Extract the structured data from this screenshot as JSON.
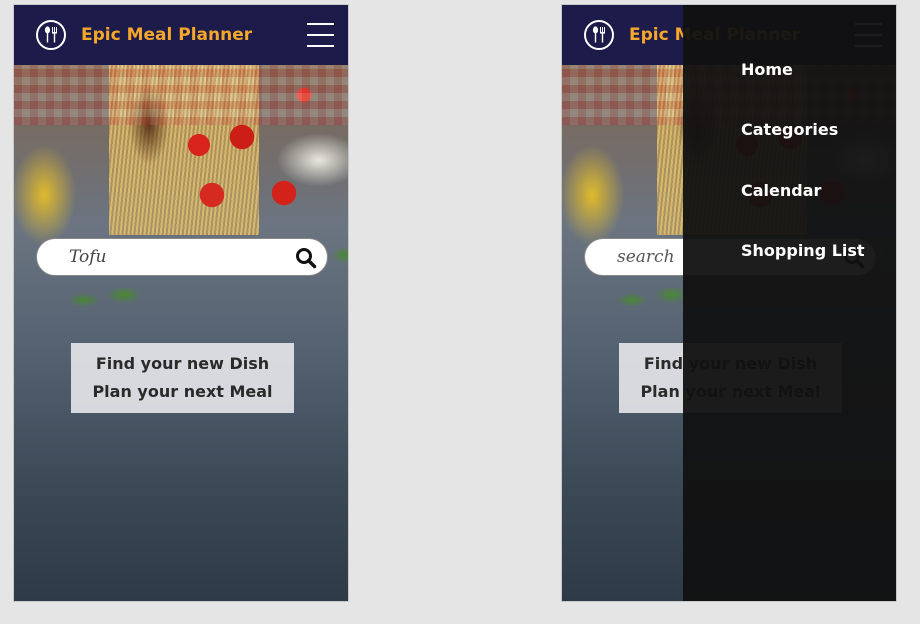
{
  "app": {
    "title": "Epic Meal Planner",
    "logo_icon": "cutlery-icon",
    "menu_icon": "hamburger-icon",
    "header_color": "#1c1b4a",
    "title_color": "#f4a72a"
  },
  "left_screen": {
    "search": {
      "value": "Tofu",
      "placeholder": "search",
      "icon": "search-icon"
    },
    "tagline": {
      "line1": "Find your new Dish",
      "line2": "Plan your next Meal"
    }
  },
  "right_screen": {
    "search": {
      "value": "",
      "placeholder": "search",
      "icon": "search-icon"
    },
    "tagline": {
      "line1": "Find your new Dish",
      "line2": "Plan your next Meal"
    },
    "menu": {
      "items": [
        {
          "label": "Home"
        },
        {
          "label": "Categories"
        },
        {
          "label": "Calendar"
        },
        {
          "label": "Shopping List"
        }
      ]
    }
  }
}
